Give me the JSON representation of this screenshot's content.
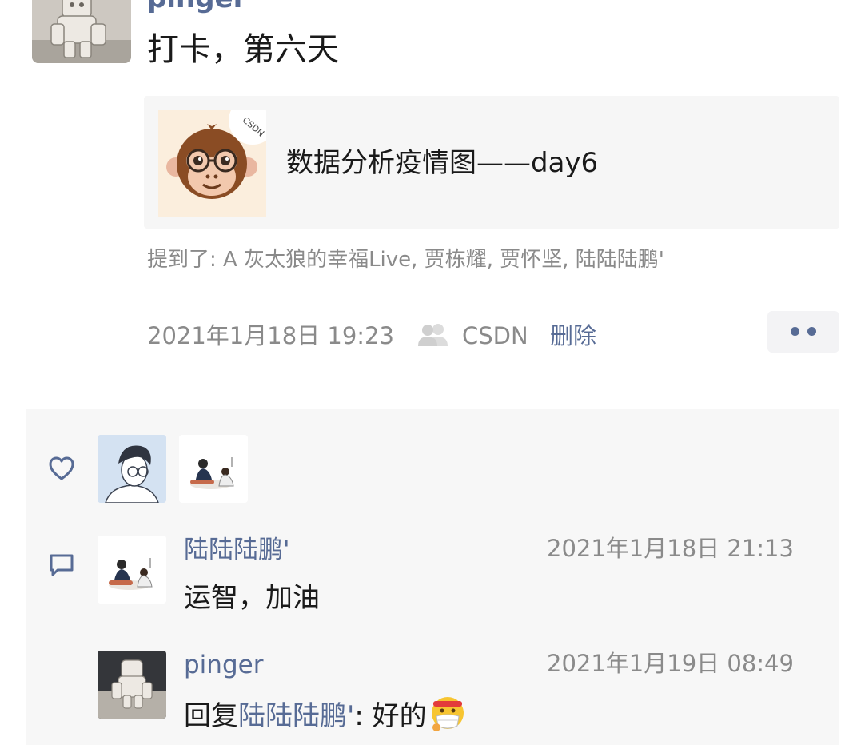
{
  "post": {
    "author": "pinger",
    "text": "打卡，第六天",
    "link": {
      "title": "数据分析疫情图——day6",
      "badge": "CSDN"
    },
    "mentions": "提到了:  A 灰太狼的幸福Live, 贾栋耀, 贾怀坚, 陆陆陆鹏'",
    "time": "2021年1月18日 19:23",
    "source": "CSDN",
    "delete_label": "删除"
  },
  "comments": [
    {
      "author": "陆陆陆鹏'",
      "time": "2021年1月18日 21:13",
      "text": "运智，加油"
    },
    {
      "author": "pinger",
      "time": "2021年1月19日 08:49",
      "reply_prefix": "回复",
      "reply_to": "陆陆陆鹏'",
      "reply_text": ": 好的"
    }
  ],
  "icons": {
    "like": "heart-icon",
    "comment": "comment-icon",
    "visibility": "group-icon",
    "more": "more-icon",
    "emoji": "mask-face-emoji"
  },
  "colors": {
    "link_blue": "#576b95",
    "meta_gray": "#8a8a8a",
    "panel_bg": "#f7f7f7"
  }
}
